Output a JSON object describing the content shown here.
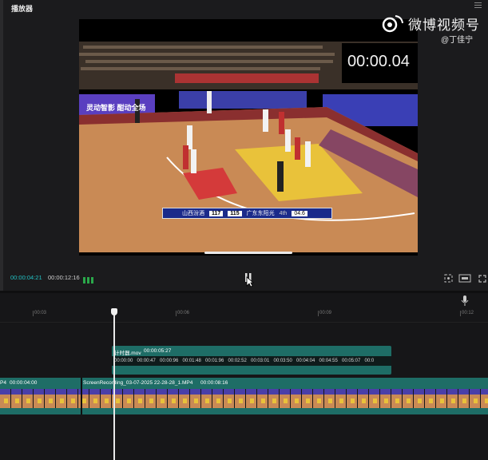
{
  "player": {
    "title": "播放器",
    "current_time": "00:00:04:21",
    "duration": "00:00:12:16"
  },
  "overlay": {
    "watermark_brand": "微博视频号",
    "watermark_user": "@丁佳宁",
    "timer": "00:00.04"
  },
  "scoreboard": {
    "home": "山西汾酒",
    "home_score": "117",
    "away_score": "115",
    "away": "广东东阳光",
    "quarter": "4th",
    "clock": "04.6"
  },
  "banner": {
    "left": "灵动智影 酣动全场"
  },
  "timeline": {
    "ruler_ticks": [
      "00:03",
      "00:06",
      "00:09",
      "00:12"
    ],
    "clip_top_name": "计时器.mov",
    "clip_top_duration": "00:00:05:27",
    "clip_top_codes": [
      "00:00:00",
      "00:00:47",
      "00:00:96",
      "00:01:48",
      "00:01:96",
      "00:02:52",
      "00:03:01",
      "00:03:50",
      "00:04:04",
      "00:04:55",
      "00:05:07",
      "00:0"
    ],
    "clip_left_name": "P4",
    "clip_left_duration": "00:00:04:00",
    "clip_main_name": "ScreenRecording_03-07-2025 22-28-28_1.MP4",
    "clip_main_duration": "00:00:08:16"
  },
  "colors": {
    "accent": "#22c1c3",
    "clip": "#1e6d66",
    "court": "#c98a55",
    "paint": "#e9c23a"
  }
}
